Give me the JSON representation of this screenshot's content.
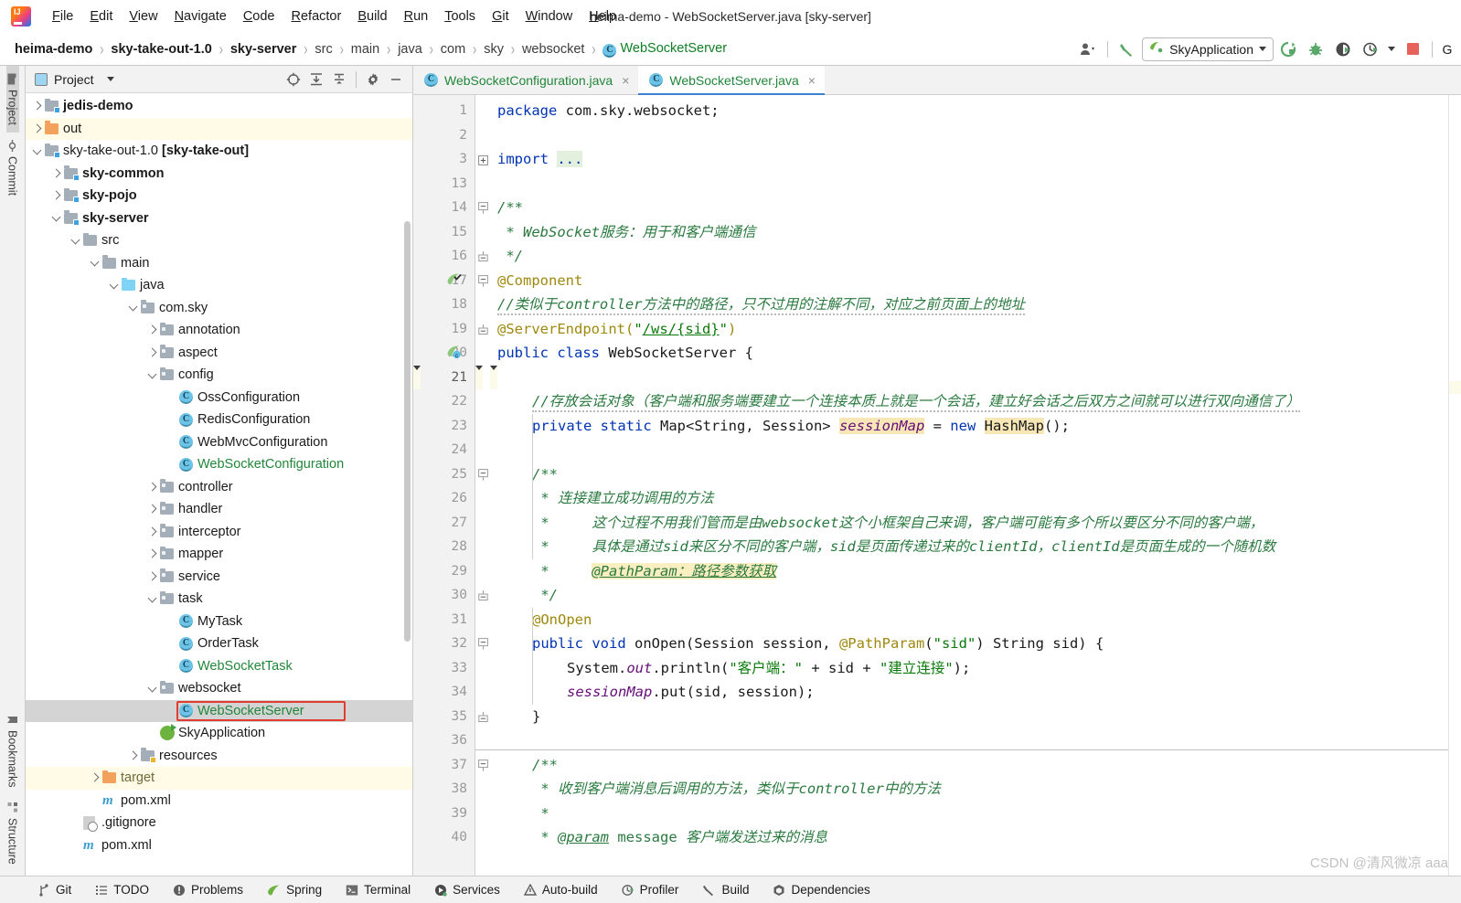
{
  "window": {
    "title": "heima-demo - WebSocketServer.java [sky-server]"
  },
  "menubar": {
    "items": [
      "File",
      "Edit",
      "View",
      "Navigate",
      "Code",
      "Refactor",
      "Build",
      "Run",
      "Tools",
      "Git",
      "Window",
      "Help"
    ]
  },
  "navbar": {
    "crumbs": [
      {
        "text": "heima-demo",
        "style": "bold"
      },
      {
        "text": "sky-take-out-1.0",
        "style": "bold"
      },
      {
        "text": "sky-server",
        "style": "bold"
      },
      {
        "text": "src",
        "style": "dim"
      },
      {
        "text": "main",
        "style": "dim"
      },
      {
        "text": "java",
        "style": "dim"
      },
      {
        "text": "com",
        "style": "dim"
      },
      {
        "text": "sky",
        "style": "dim"
      },
      {
        "text": "websocket",
        "style": "dim"
      },
      {
        "text": "WebSocketServer",
        "style": "green",
        "icon": "class-icon"
      }
    ],
    "run_config": "SkyApplication",
    "icons": [
      "user-settings-icon",
      "hammer-build-icon",
      "run-icon",
      "debug-icon",
      "run-with-coverage-icon",
      "profiler-icon",
      "stop-icon",
      "git-icon"
    ],
    "class_badge": "C",
    "trailing_label": "G"
  },
  "leftrail": {
    "top": [
      {
        "label": "Project",
        "icon": "project-folder-icon",
        "active": true
      },
      {
        "label": "Commit",
        "icon": "commit-icon",
        "active": false
      }
    ],
    "bottom": [
      {
        "label": "Bookmarks",
        "icon": "bookmark-icon"
      },
      {
        "label": "Structure",
        "icon": "structure-icon"
      }
    ]
  },
  "project_panel": {
    "title": "Project",
    "toolbar_icons": [
      "locate-icon",
      "expand-all-icon",
      "collapse-all-icon",
      "gear-icon",
      "hide-icon"
    ],
    "tree": [
      {
        "label": "jedis-demo",
        "depth": 1,
        "arrow": "right",
        "icon": "module-folder-icon",
        "bold": true,
        "color": "dk"
      },
      {
        "label": "out",
        "depth": 1,
        "arrow": "right",
        "icon": "excluded-folder-icon",
        "bold": false,
        "color": "dk",
        "highlight": "yellow"
      },
      {
        "label": "sky-take-out-1.0 [sky-take-out]",
        "depth": 1,
        "arrow": "down",
        "icon": "module-folder-icon",
        "bold": false,
        "color": "dk",
        "suffix_bold": true
      },
      {
        "label": "sky-common",
        "depth": 2,
        "arrow": "right",
        "icon": "module-folder-icon",
        "bold": true,
        "color": "dk"
      },
      {
        "label": "sky-pojo",
        "depth": 2,
        "arrow": "right",
        "icon": "module-folder-icon",
        "bold": true,
        "color": "dk"
      },
      {
        "label": "sky-server",
        "depth": 2,
        "arrow": "down",
        "icon": "module-folder-icon",
        "bold": true,
        "color": "dk"
      },
      {
        "label": "src",
        "depth": 3,
        "arrow": "down",
        "icon": "folder-icon",
        "bold": false,
        "color": "dk"
      },
      {
        "label": "main",
        "depth": 4,
        "arrow": "down",
        "icon": "folder-icon",
        "bold": false,
        "color": "dk"
      },
      {
        "label": "java",
        "depth": 5,
        "arrow": "down",
        "icon": "source-folder-icon",
        "bold": false,
        "color": "dk"
      },
      {
        "label": "com.sky",
        "depth": 6,
        "arrow": "down",
        "icon": "package-icon",
        "bold": false,
        "color": "dk"
      },
      {
        "label": "annotation",
        "depth": 7,
        "arrow": "right",
        "icon": "package-icon",
        "bold": false,
        "color": "dk"
      },
      {
        "label": "aspect",
        "depth": 7,
        "arrow": "right",
        "icon": "package-icon",
        "bold": false,
        "color": "dk"
      },
      {
        "label": "config",
        "depth": 7,
        "arrow": "down",
        "icon": "package-icon",
        "bold": false,
        "color": "dk"
      },
      {
        "label": "OssConfiguration",
        "depth": 8,
        "arrow": "none",
        "icon": "class-icon",
        "bold": false,
        "color": "dk"
      },
      {
        "label": "RedisConfiguration",
        "depth": 8,
        "arrow": "none",
        "icon": "class-icon",
        "bold": false,
        "color": "dk"
      },
      {
        "label": "WebMvcConfiguration",
        "depth": 8,
        "arrow": "none",
        "icon": "class-icon",
        "bold": false,
        "color": "dk"
      },
      {
        "label": "WebSocketConfiguration",
        "depth": 8,
        "arrow": "none",
        "icon": "class-icon",
        "bold": false,
        "color": "green"
      },
      {
        "label": "controller",
        "depth": 7,
        "arrow": "right",
        "icon": "package-icon",
        "bold": false,
        "color": "dk"
      },
      {
        "label": "handler",
        "depth": 7,
        "arrow": "right",
        "icon": "package-icon",
        "bold": false,
        "color": "dk"
      },
      {
        "label": "interceptor",
        "depth": 7,
        "arrow": "right",
        "icon": "package-icon",
        "bold": false,
        "color": "dk"
      },
      {
        "label": "mapper",
        "depth": 7,
        "arrow": "right",
        "icon": "package-icon",
        "bold": false,
        "color": "dk"
      },
      {
        "label": "service",
        "depth": 7,
        "arrow": "right",
        "icon": "package-icon",
        "bold": false,
        "color": "dk"
      },
      {
        "label": "task",
        "depth": 7,
        "arrow": "down",
        "icon": "package-icon",
        "bold": false,
        "color": "dk"
      },
      {
        "label": "MyTask",
        "depth": 8,
        "arrow": "none",
        "icon": "class-icon",
        "bold": false,
        "color": "dk"
      },
      {
        "label": "OrderTask",
        "depth": 8,
        "arrow": "none",
        "icon": "class-icon",
        "bold": false,
        "color": "dk"
      },
      {
        "label": "WebSocketTask",
        "depth": 8,
        "arrow": "none",
        "icon": "class-icon",
        "bold": false,
        "color": "green"
      },
      {
        "label": "websocket",
        "depth": 7,
        "arrow": "down",
        "icon": "package-icon",
        "bold": false,
        "color": "dk"
      },
      {
        "label": "WebSocketServer",
        "depth": 8,
        "arrow": "none",
        "icon": "class-icon",
        "bold": false,
        "color": "green",
        "highlight": "gray",
        "selected_box": true
      },
      {
        "label": "SkyApplication",
        "depth": 7,
        "arrow": "none",
        "icon": "spring-boot-icon",
        "bold": false,
        "color": "dk"
      },
      {
        "label": "resources",
        "depth": 6,
        "arrow": "right",
        "icon": "resources-folder-icon",
        "bold": false,
        "color": "dk"
      },
      {
        "label": "target",
        "depth": 4,
        "arrow": "right",
        "icon": "excluded-folder-icon",
        "bold": false,
        "color": "olive",
        "highlight": "yellow"
      },
      {
        "label": "pom.xml",
        "depth": 4,
        "arrow": "none",
        "icon": "maven-icon",
        "bold": false,
        "color": "dk"
      },
      {
        "label": ".gitignore",
        "depth": 3,
        "arrow": "none",
        "icon": "gitignore-icon",
        "bold": false,
        "color": "dk"
      },
      {
        "label": "pom.xml",
        "depth": 3,
        "arrow": "none",
        "icon": "maven-icon",
        "bold": false,
        "color": "dk"
      }
    ]
  },
  "editor": {
    "tabs": [
      {
        "label": "WebSocketConfiguration.java",
        "active": false,
        "icon": "class-icon",
        "close": "×"
      },
      {
        "label": "WebSocketServer.java",
        "active": true,
        "icon": "class-icon",
        "close": "×"
      }
    ],
    "lines": [
      {
        "n": "1",
        "segs": [
          {
            "t": "package",
            "c": "kw"
          },
          {
            "t": " com.sky.websocket;",
            "c": "nm"
          }
        ]
      },
      {
        "n": "2",
        "segs": []
      },
      {
        "n": "3",
        "segs": [
          {
            "t": "import",
            "c": "kw"
          },
          {
            "t": " ",
            "c": "nm"
          },
          {
            "t": "...",
            "c": "imp"
          }
        ],
        "fold": "plus"
      },
      {
        "n": "13",
        "segs": []
      },
      {
        "n": "14",
        "segs": [
          {
            "t": "/**",
            "c": "cm"
          }
        ],
        "indent": 1,
        "fold": "top"
      },
      {
        "n": "15",
        "segs": [
          {
            "t": " * WebSocket服务：用于和客户端通信",
            "c": "cm"
          }
        ],
        "indent": 1
      },
      {
        "n": "16",
        "segs": [
          {
            "t": " */",
            "c": "cm"
          }
        ],
        "indent": 1,
        "fold": "bottom"
      },
      {
        "n": "17",
        "segs": [
          {
            "t": "@Component",
            "c": "an"
          }
        ],
        "indent": 1,
        "badge": "spring-bean-icon",
        "fold": "top"
      },
      {
        "n": "18",
        "segs": [
          {
            "t": "//类似于controller方法中的路径，只不过用的注解不同，对应之前页面上的地址",
            "c": "cm-wavy"
          }
        ],
        "indent": 1
      },
      {
        "n": "19",
        "segs": [
          {
            "t": "@ServerEndpoint(",
            "c": "an"
          },
          {
            "t": "\"",
            "c": "st"
          },
          {
            "t": "/ws/{sid}",
            "c": "st-ul"
          },
          {
            "t": "\"",
            "c": "st"
          },
          {
            "t": ")",
            "c": "an"
          }
        ],
        "indent": 1,
        "fold": "bottom"
      },
      {
        "n": "20",
        "segs": [
          {
            "t": "public class",
            "c": "kw"
          },
          {
            "t": " WebSocketServer {",
            "c": "nm"
          }
        ],
        "indent": 1,
        "badge": "spring-endpoint-icon"
      },
      {
        "n": "21",
        "segs": [],
        "caret": true
      },
      {
        "n": "22",
        "segs": [
          {
            "t": "//存放会话对象（客户端和服务端要建立一个连接本质上就是一个会话，建立好会话之后双方之间就可以进行双向通信了）",
            "c": "cm-wavy"
          }
        ],
        "indent": 2
      },
      {
        "n": "23",
        "segs": [
          {
            "t": "private static",
            "c": "kw"
          },
          {
            "t": " Map<String, Session> ",
            "c": "nm"
          },
          {
            "t": "sessionMap",
            "c": "fld-hl"
          },
          {
            "t": " = ",
            "c": "nm"
          },
          {
            "t": "new",
            "c": "kw"
          },
          {
            "t": " ",
            "c": "nm"
          },
          {
            "t": "HashMap",
            "c": "hl"
          },
          {
            "t": "();",
            "c": "nm"
          }
        ],
        "indent": 2
      },
      {
        "n": "24",
        "segs": []
      },
      {
        "n": "25",
        "segs": [
          {
            "t": "/**",
            "c": "cm"
          }
        ],
        "indent": 2,
        "fold": "top"
      },
      {
        "n": "26",
        "segs": [
          {
            "t": " * 连接建立成功调用的方法",
            "c": "cm"
          }
        ],
        "indent": 2
      },
      {
        "n": "27",
        "segs": [
          {
            "t": " *     这个过程不用我们管而是由websocket这个小框架自己来调，客户端可能有多个所以要区分不同的客户端，",
            "c": "cm"
          }
        ],
        "indent": 2
      },
      {
        "n": "28",
        "segs": [
          {
            "t": " *     具体是通过sid来区分不同的客户端，sid是页面传递过来的clientId，clientId是页面生成的一个随机数",
            "c": "cm"
          }
        ],
        "indent": 2
      },
      {
        "n": "29",
        "segs": [
          {
            "t": " *     ",
            "c": "cm"
          },
          {
            "t": "@PathParam：路径参数获取",
            "c": "cm-hl"
          }
        ],
        "indent": 2
      },
      {
        "n": "30",
        "segs": [
          {
            "t": " */",
            "c": "cm"
          }
        ],
        "indent": 2,
        "fold": "bottom"
      },
      {
        "n": "31",
        "segs": [
          {
            "t": "@OnOpen",
            "c": "an"
          }
        ],
        "indent": 2
      },
      {
        "n": "32",
        "segs": [
          {
            "t": "public void",
            "c": "kw"
          },
          {
            "t": " onOpen(Session session, ",
            "c": "nm"
          },
          {
            "t": "@PathParam",
            "c": "an"
          },
          {
            "t": "(",
            "c": "nm"
          },
          {
            "t": "\"sid\"",
            "c": "st"
          },
          {
            "t": ") String sid) {",
            "c": "nm"
          }
        ],
        "indent": 2,
        "fold": "top"
      },
      {
        "n": "33",
        "segs": [
          {
            "t": "System.",
            "c": "nm"
          },
          {
            "t": "out",
            "c": "fld"
          },
          {
            "t": ".println(",
            "c": "nm"
          },
          {
            "t": "\"客户端：\"",
            "c": "st"
          },
          {
            "t": " + sid + ",
            "c": "nm"
          },
          {
            "t": "\"建立连接\"",
            "c": "st"
          },
          {
            "t": ");",
            "c": "nm"
          }
        ],
        "indent": 3
      },
      {
        "n": "34",
        "segs": [
          {
            "t": "sessionMap",
            "c": "fld"
          },
          {
            "t": ".put(sid, session);",
            "c": "nm"
          }
        ],
        "indent": 3
      },
      {
        "n": "35",
        "segs": [
          {
            "t": "}",
            "c": "nm"
          }
        ],
        "indent": 2,
        "fold": "bottom"
      },
      {
        "n": "36",
        "segs": []
      },
      {
        "n": "37",
        "segs": [
          {
            "t": "/**",
            "c": "cm"
          }
        ],
        "indent": 2,
        "fold": "top",
        "sep_above": true
      },
      {
        "n": "38",
        "segs": [
          {
            "t": " * 收到客户端消息后调用的方法，类似于controller中的方法",
            "c": "cm"
          }
        ],
        "indent": 2
      },
      {
        "n": "39",
        "segs": [
          {
            "t": " *",
            "c": "cm"
          }
        ],
        "indent": 2
      },
      {
        "n": "40",
        "segs": [
          {
            "t": " * ",
            "c": "cm"
          },
          {
            "t": "@param",
            "c": "cm-ul"
          },
          {
            "t": " message ",
            "c": "cm-plain"
          },
          {
            "t": "客户端发送过来的消息",
            "c": "cm"
          }
        ],
        "indent": 2
      }
    ]
  },
  "statusbar": {
    "items": [
      {
        "label": "Git",
        "icon": "git-branch-icon"
      },
      {
        "label": "TODO",
        "icon": "todo-list-icon"
      },
      {
        "label": "Problems",
        "icon": "problems-icon"
      },
      {
        "label": "Spring",
        "icon": "spring-leaf-icon"
      },
      {
        "label": "Terminal",
        "icon": "terminal-icon"
      },
      {
        "label": "Services",
        "icon": "services-icon"
      },
      {
        "label": "Auto-build",
        "icon": "auto-build-icon"
      },
      {
        "label": "Profiler",
        "icon": "profiler-icon"
      },
      {
        "label": "Build",
        "icon": "build-hammer-icon"
      },
      {
        "label": "Dependencies",
        "icon": "dependencies-icon"
      }
    ]
  },
  "watermark": "CSDN @清风微凉 aaa",
  "colors": {
    "accent_blue": "#3f7fd0",
    "green_text": "#22863a",
    "comment_green": "#2a7a3f",
    "keyword_blue": "#0033b3",
    "annotation_yellow": "#9e880d",
    "string_green": "#0a7a0a",
    "field_purple": "#660e7a",
    "selection_red_box": "#e03c31",
    "caret_row": "#fcfae8",
    "highlight_yellow_row": "#fffbe6"
  }
}
